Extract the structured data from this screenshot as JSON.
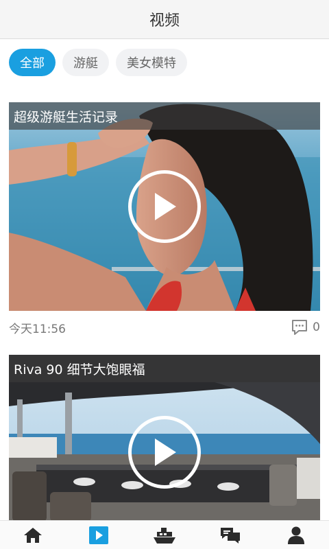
{
  "header": {
    "title": "视频"
  },
  "filters": [
    {
      "label": "全部",
      "active": true
    },
    {
      "label": "游艇",
      "active": false
    },
    {
      "label": "美女模特",
      "active": false
    }
  ],
  "videos": [
    {
      "title": "超级游艇生活记录",
      "time": "今天11:56",
      "comments": "0"
    },
    {
      "title": "Riva 90 细节大饱眼福"
    }
  ],
  "tabbar": {
    "items": [
      {
        "icon": "home-icon",
        "active": false
      },
      {
        "icon": "video-play-icon",
        "active": true
      },
      {
        "icon": "yacht-icon",
        "active": false
      },
      {
        "icon": "chat-icon",
        "active": false
      },
      {
        "icon": "profile-icon",
        "active": false
      }
    ]
  },
  "colors": {
    "accent": "#1a9fe0",
    "text": "#333333",
    "muted": "#777777",
    "nav": "#2b2b2b"
  }
}
